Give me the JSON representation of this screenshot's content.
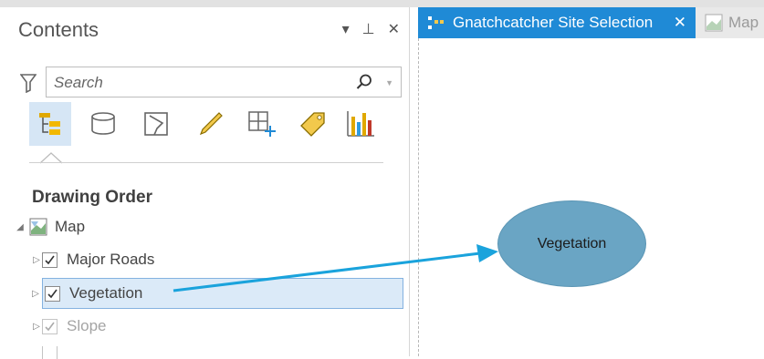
{
  "contents_pane": {
    "title": "Contents",
    "controls": {
      "menu": "▾",
      "pin": "⊥",
      "close": "✕"
    },
    "search": {
      "placeholder": "Search"
    },
    "tools": [
      "list-by-drawing-order-icon",
      "list-by-source-icon",
      "list-by-selection-icon",
      "list-by-editing-icon",
      "list-by-snapping-icon",
      "list-by-labeling-icon",
      "list-by-charts-icon"
    ],
    "section_title": "Drawing Order",
    "map_label": "Map",
    "layers": [
      {
        "label": "Major Roads",
        "checked": true,
        "selected": false,
        "dim": false
      },
      {
        "label": "Vegetation",
        "checked": true,
        "selected": true,
        "dim": false
      },
      {
        "label": "Slope",
        "checked": true,
        "selected": false,
        "dim": true
      }
    ]
  },
  "tabs": {
    "active": {
      "label": "Gnatchcatcher Site Selection",
      "close": "✕"
    },
    "inactive": {
      "label": "Map"
    }
  },
  "callout": {
    "label": "Vegetation"
  },
  "colors": {
    "accent": "#1f8ad6",
    "callout": "#6aa5c4",
    "arrow": "#1aa3dc",
    "selection": "#dbeaf8"
  }
}
